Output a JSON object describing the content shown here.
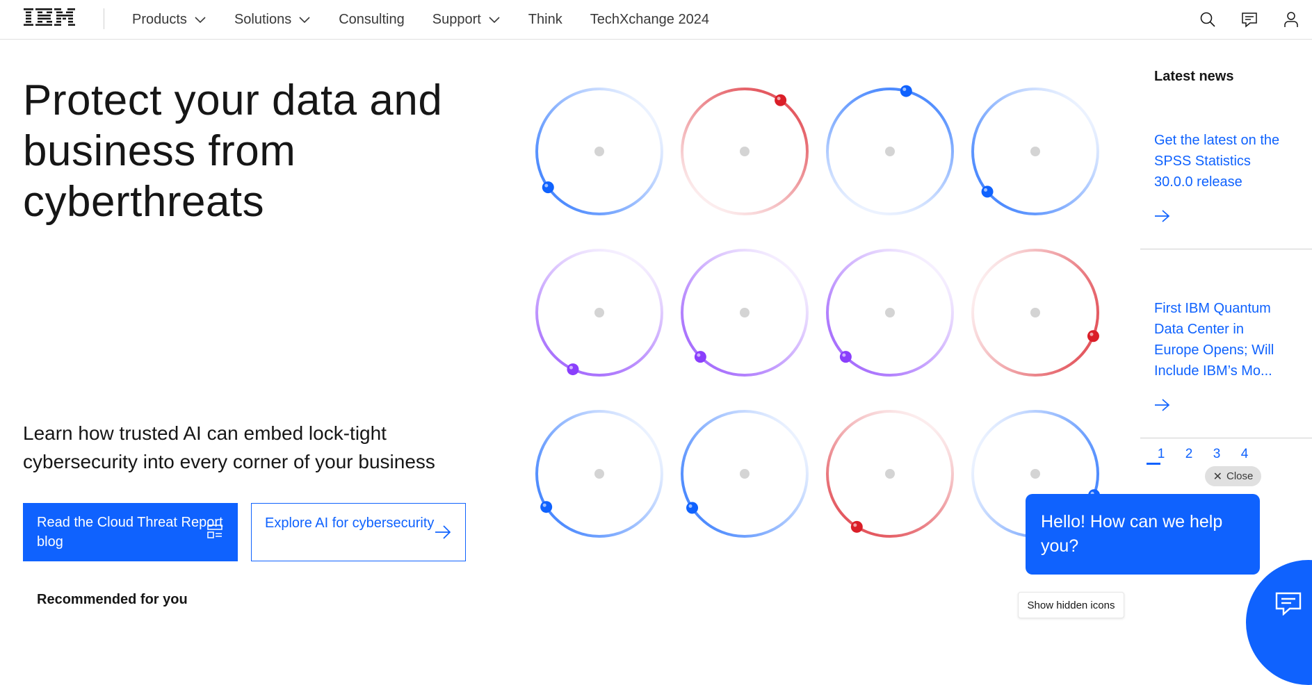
{
  "header": {
    "logo_text": "IBM",
    "nav": [
      {
        "label": "Products",
        "has_menu": true
      },
      {
        "label": "Solutions",
        "has_menu": true
      },
      {
        "label": "Consulting",
        "has_menu": false
      },
      {
        "label": "Support",
        "has_menu": true
      },
      {
        "label": "Think",
        "has_menu": false
      },
      {
        "label": "TechXchange 2024",
        "has_menu": false
      }
    ],
    "tools": [
      "search-icon",
      "chat-icon",
      "user-icon"
    ]
  },
  "hero": {
    "title": "Protect your data and business from cyberthreats",
    "subtitle": "Learn how trusted AI can embed lock-tight cybersecurity into every corner of your business",
    "primary_button": "Read the Cloud Threat Report blog",
    "secondary_button": "Explore AI for cybersecurity",
    "recommended": "Recommended for you"
  },
  "news": {
    "heading": "Latest news",
    "items": [
      {
        "title": "Get the latest on the SPSS Statistics 30.0.0 release"
      },
      {
        "title": "First IBM Quantum Data Center in Europe Opens; Will Include IBM’s Mo..."
      }
    ],
    "pages": [
      "1",
      "2",
      "3",
      "4"
    ],
    "active_page": "1"
  },
  "chat": {
    "close_label": "Close",
    "greeting": "Hello! How can we help you?",
    "hidden_icons_label": "Show hidden icons"
  },
  "colors": {
    "accent": "#0f62fe",
    "blue": "#0f62fe",
    "red": "#da1e28",
    "purple": "#8a3ffc"
  },
  "dials": [
    {
      "color": "blue",
      "angle": 235
    },
    {
      "color": "red",
      "angle": 35
    },
    {
      "color": "blue",
      "angle": 15
    },
    {
      "color": "blue",
      "angle": 230
    },
    {
      "color": "purple",
      "angle": 205
    },
    {
      "color": "purple",
      "angle": 225
    },
    {
      "color": "purple",
      "angle": 225
    },
    {
      "color": "red",
      "angle": 112
    },
    {
      "color": "blue",
      "angle": 238
    },
    {
      "color": "blue",
      "angle": 237
    },
    {
      "color": "red",
      "angle": 212
    },
    {
      "color": "blue",
      "angle": 110
    }
  ]
}
